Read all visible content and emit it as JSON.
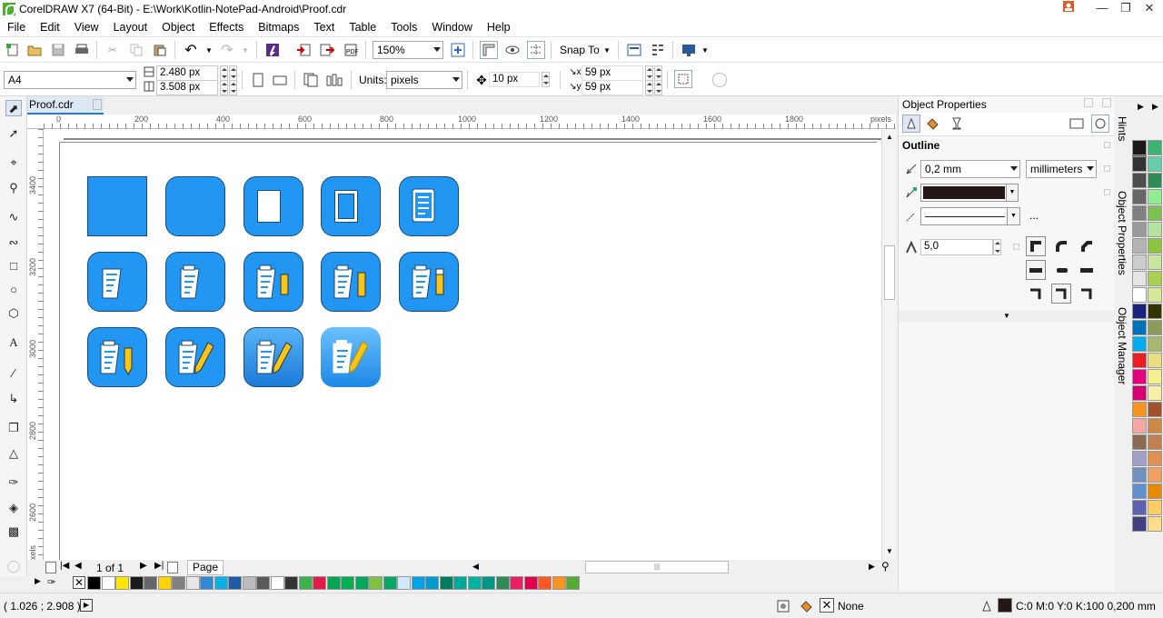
{
  "window": {
    "title": "CorelDRAW X7 (64-Bit) - E:\\Work\\Kotlin-NotePad-Android\\Proof.cdr"
  },
  "menu": [
    "File",
    "Edit",
    "View",
    "Layout",
    "Object",
    "Effects",
    "Bitmaps",
    "Text",
    "Table",
    "Tools",
    "Window",
    "Help"
  ],
  "standard_toolbar": {
    "zoom": "150%",
    "snap_label": "Snap To"
  },
  "property_bar": {
    "page_size": "A4",
    "width": "2.480 px",
    "height": "3.508 px",
    "units_label": "Units:",
    "units_value": "pixels",
    "nudge": "10 px",
    "dup_x": "59 px",
    "dup_y": "59 px"
  },
  "document_tab": "Proof.cdr",
  "ruler": {
    "h_labels": [
      "0",
      "200",
      "400",
      "600",
      "800",
      "1000",
      "1200",
      "1400",
      "1600",
      "1800",
      "pixels"
    ],
    "v_labels": [
      "3400",
      "3200",
      "3000",
      "2800",
      "2600",
      "pixels"
    ]
  },
  "page_nav": {
    "counter": "1 of 1",
    "page_tab": "Page 1"
  },
  "docker": {
    "title": "Object Properties",
    "section": "Outline",
    "width_value": "0,2 mm",
    "units_value": "millimeters",
    "miter_value": "5,0",
    "ellipsis": "..."
  },
  "docker_tabs": [
    "Hints",
    "Object Properties",
    "Object Manager"
  ],
  "statusbar": {
    "coords": "( 1.026 ; 2.908 )",
    "fill_text": "None",
    "outline_text": "C:0 M:0 Y:0 K:100  0,200 mm"
  },
  "colors": {
    "accent": "#2196f3",
    "outline_swatch": "#231815"
  },
  "bottom_palette": [
    "#000000",
    "#ffffff",
    "#ffe600",
    "#1a1a1a",
    "#666666",
    "#ffd200",
    "#808080",
    "#e6e6e6",
    "#2f89d6",
    "#0ab0e6",
    "#1f5ca8",
    "#bbbbbb",
    "#5a5a5a",
    "#ffffff",
    "#333333",
    "#3cb44b",
    "#e6194b",
    "#00a651",
    "#00b050",
    "#00a859",
    "#7fc241",
    "#00aa66",
    "#d0e8ff",
    "#00a2e8",
    "#009ad0",
    "#007f5f",
    "#00a99d",
    "#00b3a0",
    "#009688",
    "#2e8b57",
    "#e91e63",
    "#e0004d",
    "#ff5722",
    "#f7941d",
    "#55aa33"
  ],
  "right_palette": [
    "#1a1a1a",
    "#3cb371",
    "#333333",
    "#66cdaa",
    "#4d4d4d",
    "#2e8b57",
    "#666666",
    "#90ee90",
    "#808080",
    "#7cbf52",
    "#999999",
    "#b3e3a3",
    "#b3b3b3",
    "#8cc63f",
    "#cccccc",
    "#c8e6a0",
    "#e6e6e6",
    "#aacf53",
    "#ffffff",
    "#d6e99a",
    "#1a237e",
    "#333300",
    "#0072bc",
    "#8c9a5a",
    "#00aeef",
    "#a8b870",
    "#ed1c24",
    "#e8e080",
    "#e6007e",
    "#f4f090",
    "#d6006f",
    "#f7f0a8",
    "#f7941d",
    "#a0522d",
    "#f4a7a0",
    "#cc8844",
    "#8c6a50",
    "#c08050",
    "#a0a0c8",
    "#e09050",
    "#7090c0",
    "#f0a060",
    "#6090d0",
    "#e68a00",
    "#6060b0",
    "#ffcc66",
    "#404080",
    "#ffdd88"
  ]
}
